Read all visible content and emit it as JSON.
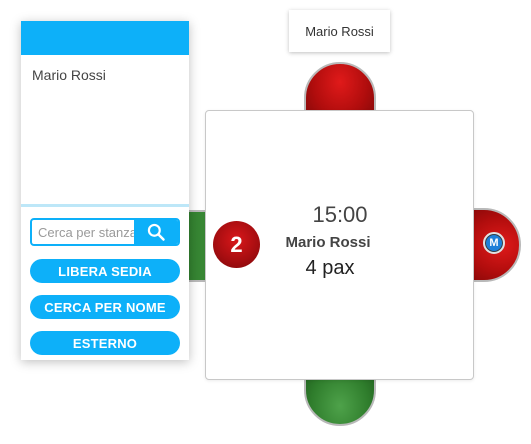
{
  "name_tooltip": {
    "text": "Mario Rossi"
  },
  "panel": {
    "list_items": [
      "Mario Rossi"
    ],
    "search": {
      "placeholder": "Cerca per stanza",
      "icon": "search-icon"
    },
    "buttons": {
      "free_seat": "LIBERA SEDIA",
      "search_by_name": "CERCA PER NOME",
      "external": "ESTERNO"
    },
    "accent_color": "#0db0f9"
  },
  "table": {
    "number": "2",
    "time": "15:00",
    "guest_name": "Mario Rossi",
    "pax": "4 pax",
    "badge_letter": "M",
    "seats": {
      "top": "occupied",
      "right": "occupied",
      "bottom": "free",
      "left": "free"
    },
    "colors": {
      "occupied": "#b10d0d",
      "free": "#2f7d2c"
    }
  }
}
